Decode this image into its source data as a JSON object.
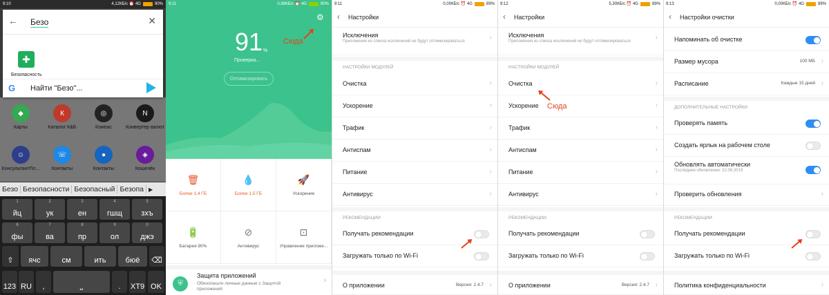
{
  "p1": {
    "status": {
      "time": "9:10",
      "right": "4,12КБ/с ⏰ 4G",
      "battery": "90%"
    },
    "search": {
      "query": "Безо"
    },
    "result_app": {
      "label": "Безопасность"
    },
    "find": {
      "label": "Найти \"Безо\"..."
    },
    "apps": [
      {
        "label": "Карты",
        "color": "#34a853",
        "glyph": "◆"
      },
      {
        "label": "Каталог К&Б",
        "color": "#c0392b",
        "glyph": "К"
      },
      {
        "label": "Компас",
        "color": "#222222",
        "glyph": "◎"
      },
      {
        "label": "Конвертер валют",
        "color": "#1a1a1a",
        "glyph": "N"
      },
      {
        "label": "КонсультантПл...",
        "color": "#2c3e8c",
        "glyph": "☺"
      },
      {
        "label": "Контакты",
        "color": "#1e88e5",
        "glyph": "☏"
      },
      {
        "label": "Контакты",
        "color": "#1565c0",
        "glyph": "●"
      },
      {
        "label": "Кошелёк",
        "color": "#6a1b9a",
        "glyph": "◈"
      }
    ],
    "suggestions": [
      "Безо",
      "Безопасности",
      "Безопасный",
      "Безопа"
    ],
    "keys_row1": [
      {
        "n": "1",
        "t": "йц"
      },
      {
        "n": "2",
        "t": "ук"
      },
      {
        "n": "3",
        "t": "ен"
      },
      {
        "n": "4",
        "t": "гшщ"
      },
      {
        "n": "5",
        "t": "зхъ"
      }
    ],
    "keys_row2": [
      {
        "n": "6",
        "t": "фы"
      },
      {
        "n": "7",
        "t": "ва"
      },
      {
        "n": "8",
        "t": "пр"
      },
      {
        "n": "9",
        "t": "ол"
      },
      {
        "n": "0",
        "t": "джэ"
      }
    ],
    "keys_row3": [
      {
        "n": "",
        "t": "⇧"
      },
      {
        "n": "",
        "t": "ячс"
      },
      {
        "n": "",
        "t": "см"
      },
      {
        "n": "",
        "t": "ить"
      },
      {
        "n": "",
        "t": "бюё"
      },
      {
        "n": "",
        "t": "⌫"
      }
    ],
    "keys_row4": [
      {
        "t": "123"
      },
      {
        "t": "RU"
      },
      {
        "t": ","
      },
      {
        "t": "⎵"
      },
      {
        "t": "."
      },
      {
        "t": "XT9"
      },
      {
        "t": "OK"
      }
    ]
  },
  "p2": {
    "status": {
      "time": "9:11",
      "right": "0,98КБ/с ⏰ 4G",
      "battery": "90%"
    },
    "score": "91",
    "pct": "%",
    "checking": "Проверка...",
    "optimize": "Оптимизировать",
    "here": "Сюда",
    "cells": [
      {
        "icon": "🗑",
        "label": "Более 1,4 ГБ",
        "red": true
      },
      {
        "icon": "💧",
        "label": "Более 1,5 ГБ",
        "red": true
      },
      {
        "icon": "🚀",
        "label": "Ускорение",
        "red": false
      },
      {
        "icon": "🔋",
        "label": "Батарея 90%",
        "red": false
      },
      {
        "icon": "⊘",
        "label": "Антивирус",
        "red": false
      },
      {
        "icon": "⊡",
        "label": "Управление приложе...",
        "red": false
      }
    ],
    "protect": {
      "title": "Защита приложений",
      "desc": "Обезопасьте личные данные с Защитой приложений"
    }
  },
  "p3": {
    "status": {
      "time": "9:11",
      "right": "0,00КБ/с ⏰ 4G",
      "battery": "89%"
    },
    "title": "Настройки",
    "exceptions": {
      "label": "Исключения",
      "sub": "Приложения из списка исключений не будут оптимизироваться"
    },
    "section_modules": "НАСТРОЙКИ МОДУЛЕЙ",
    "modules": [
      "Очистка",
      "Ускорение",
      "Трафик",
      "Антиспам",
      "Питание",
      "Антивирус"
    ],
    "section_rec": "РЕКОМЕНДАЦИИ",
    "rec": [
      "Получать рекомендации",
      "Загружать только по Wi-Fi"
    ],
    "about": {
      "label": "О приложении",
      "value": "Версия: 2.4.7"
    }
  },
  "p4": {
    "status": {
      "time": "9:12",
      "right": "5,30КБ/с ⏰ 4G",
      "battery": "89%"
    },
    "here": "Сюда"
  },
  "p5": {
    "status": {
      "time": "9:13",
      "right": "0,00КБ/с ⏰ 4G",
      "battery": "89%"
    },
    "title": "Настройки очистки",
    "remind": "Напоминать об очистке",
    "trash": {
      "label": "Размер мусора",
      "value": "100 МБ"
    },
    "schedule": {
      "label": "Расписание",
      "value": "Каждые 15 дней"
    },
    "section_extra": "ДОПОЛНИТЕЛЬНЫЕ НАСТРОЙКИ",
    "memory": "Проверять память",
    "shortcut": "Создать ярлык на рабочем столе",
    "autoupdate": {
      "label": "Обновлять автоматически",
      "sub": "Последнее обновление: 22.08.2019"
    },
    "check_updates": "Проверить обновления",
    "section_rec": "РЕКОМЕНДАЦИИ",
    "rec": [
      "Получать рекомендации",
      "Загружать только по Wi-Fi"
    ],
    "privacy": "Политика конфиденциальности"
  }
}
